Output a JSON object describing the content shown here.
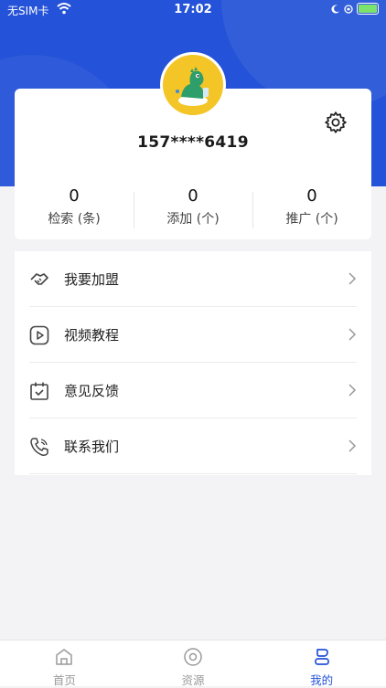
{
  "status_bar": {
    "carrier": "无SIM卡",
    "time": "17:02"
  },
  "profile": {
    "phone": "157****6419"
  },
  "stats": [
    {
      "value": "0",
      "label": "检索 (条)"
    },
    {
      "value": "0",
      "label": "添加 (个)"
    },
    {
      "value": "0",
      "label": "推广 (个)"
    }
  ],
  "menu": [
    {
      "label": "我要加盟",
      "icon": "handshake-icon"
    },
    {
      "label": "视频教程",
      "icon": "play-icon"
    },
    {
      "label": "意见反馈",
      "icon": "calendar-check-icon"
    },
    {
      "label": "联系我们",
      "icon": "phone-icon"
    }
  ],
  "tabs": [
    {
      "label": "首页",
      "icon": "home-icon"
    },
    {
      "label": "资源",
      "icon": "resource-icon"
    },
    {
      "label": "我的",
      "icon": "profile-icon"
    }
  ],
  "colors": {
    "accent": "#2452d8",
    "avatar_bg": "#f4c527"
  }
}
